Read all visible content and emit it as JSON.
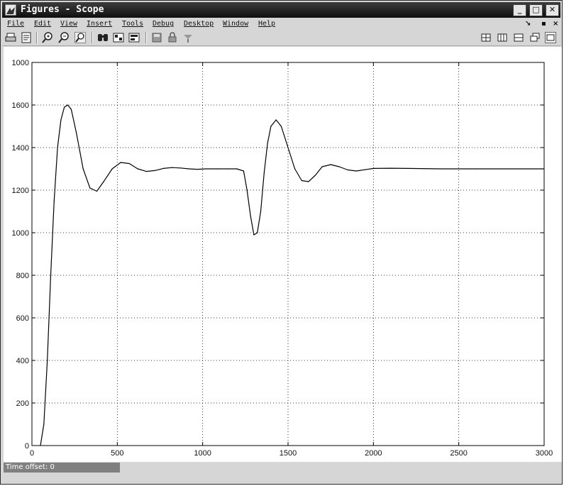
{
  "window": {
    "title": "Figures - Scope"
  },
  "menu": {
    "items": [
      "File",
      "Edit",
      "View",
      "Insert",
      "Tools",
      "Debug",
      "Desktop",
      "Window",
      "Help"
    ]
  },
  "toolbar": {
    "left_icons": [
      "print-icon",
      "print-preview-icon",
      "zoom-in-icon",
      "zoom-out-icon",
      "zoom-x-icon",
      "find-icon",
      "copy-icon",
      "params-icon",
      "save-icon",
      "lock-icon",
      "float-icon"
    ],
    "right_icons": [
      "layout-grid-icon",
      "layout-columns-icon",
      "layout-rows-icon",
      "undock-icon",
      "window-icon"
    ]
  },
  "status": {
    "time_offset": "Time offset:  0"
  },
  "chart_data": {
    "type": "line",
    "title": "",
    "xlabel": "",
    "ylabel": "",
    "xlim": [
      0,
      3000
    ],
    "ylim": [
      0,
      1800
    ],
    "xticks": [
      0,
      500,
      1000,
      1500,
      2000,
      2500,
      3000
    ],
    "xtick_labels": [
      "0",
      "500",
      "1000",
      "1500",
      "2000",
      "2500",
      "3000"
    ],
    "yticks": [
      0,
      200,
      400,
      600,
      800,
      1000,
      1200,
      1400,
      1600,
      1800
    ],
    "ytick_labels": [
      "0",
      "200",
      "400",
      "600",
      "800",
      "1000",
      "1200",
      "1400",
      "1600",
      "1000"
    ],
    "grid": true,
    "series": [
      {
        "line_color": "#000000",
        "x": [
          50,
          70,
          90,
          110,
          130,
          150,
          170,
          190,
          210,
          230,
          260,
          300,
          340,
          380,
          420,
          470,
          520,
          570,
          620,
          670,
          720,
          770,
          820,
          870,
          920,
          970,
          1020,
          1080,
          1150,
          1200,
          1240,
          1260,
          1280,
          1300,
          1320,
          1340,
          1360,
          1380,
          1400,
          1430,
          1460,
          1500,
          1540,
          1580,
          1620,
          1660,
          1700,
          1750,
          1800,
          1850,
          1900,
          1950,
          2000,
          2100,
          2200,
          2400,
          2600,
          2800,
          3000
        ],
        "y": [
          0,
          100,
          400,
          800,
          1150,
          1400,
          1530,
          1590,
          1600,
          1580,
          1470,
          1300,
          1210,
          1195,
          1240,
          1300,
          1330,
          1325,
          1300,
          1288,
          1292,
          1302,
          1306,
          1304,
          1300,
          1298,
          1300,
          1300,
          1300,
          1300,
          1290,
          1200,
          1080,
          990,
          1000,
          1100,
          1280,
          1420,
          1500,
          1530,
          1500,
          1400,
          1300,
          1245,
          1240,
          1270,
          1310,
          1320,
          1310,
          1295,
          1290,
          1296,
          1302,
          1303,
          1302,
          1300,
          1300,
          1300,
          1300
        ]
      }
    ]
  }
}
